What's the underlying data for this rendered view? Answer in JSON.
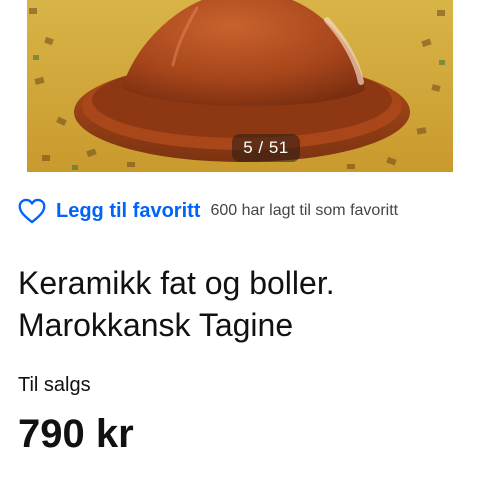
{
  "gallery": {
    "counter": "5 / 51",
    "image": "tagine-photo"
  },
  "favorite": {
    "icon": "heart-outline-icon",
    "label": "Legg til favoritt",
    "count_text": "600 har lagt til som favoritt",
    "accent": "#0063fb"
  },
  "listing": {
    "title_line1": "Keramikk fat og boller.",
    "title_line2": "Marokkansk Tagine",
    "status": "Til salgs",
    "price": "790 kr"
  }
}
